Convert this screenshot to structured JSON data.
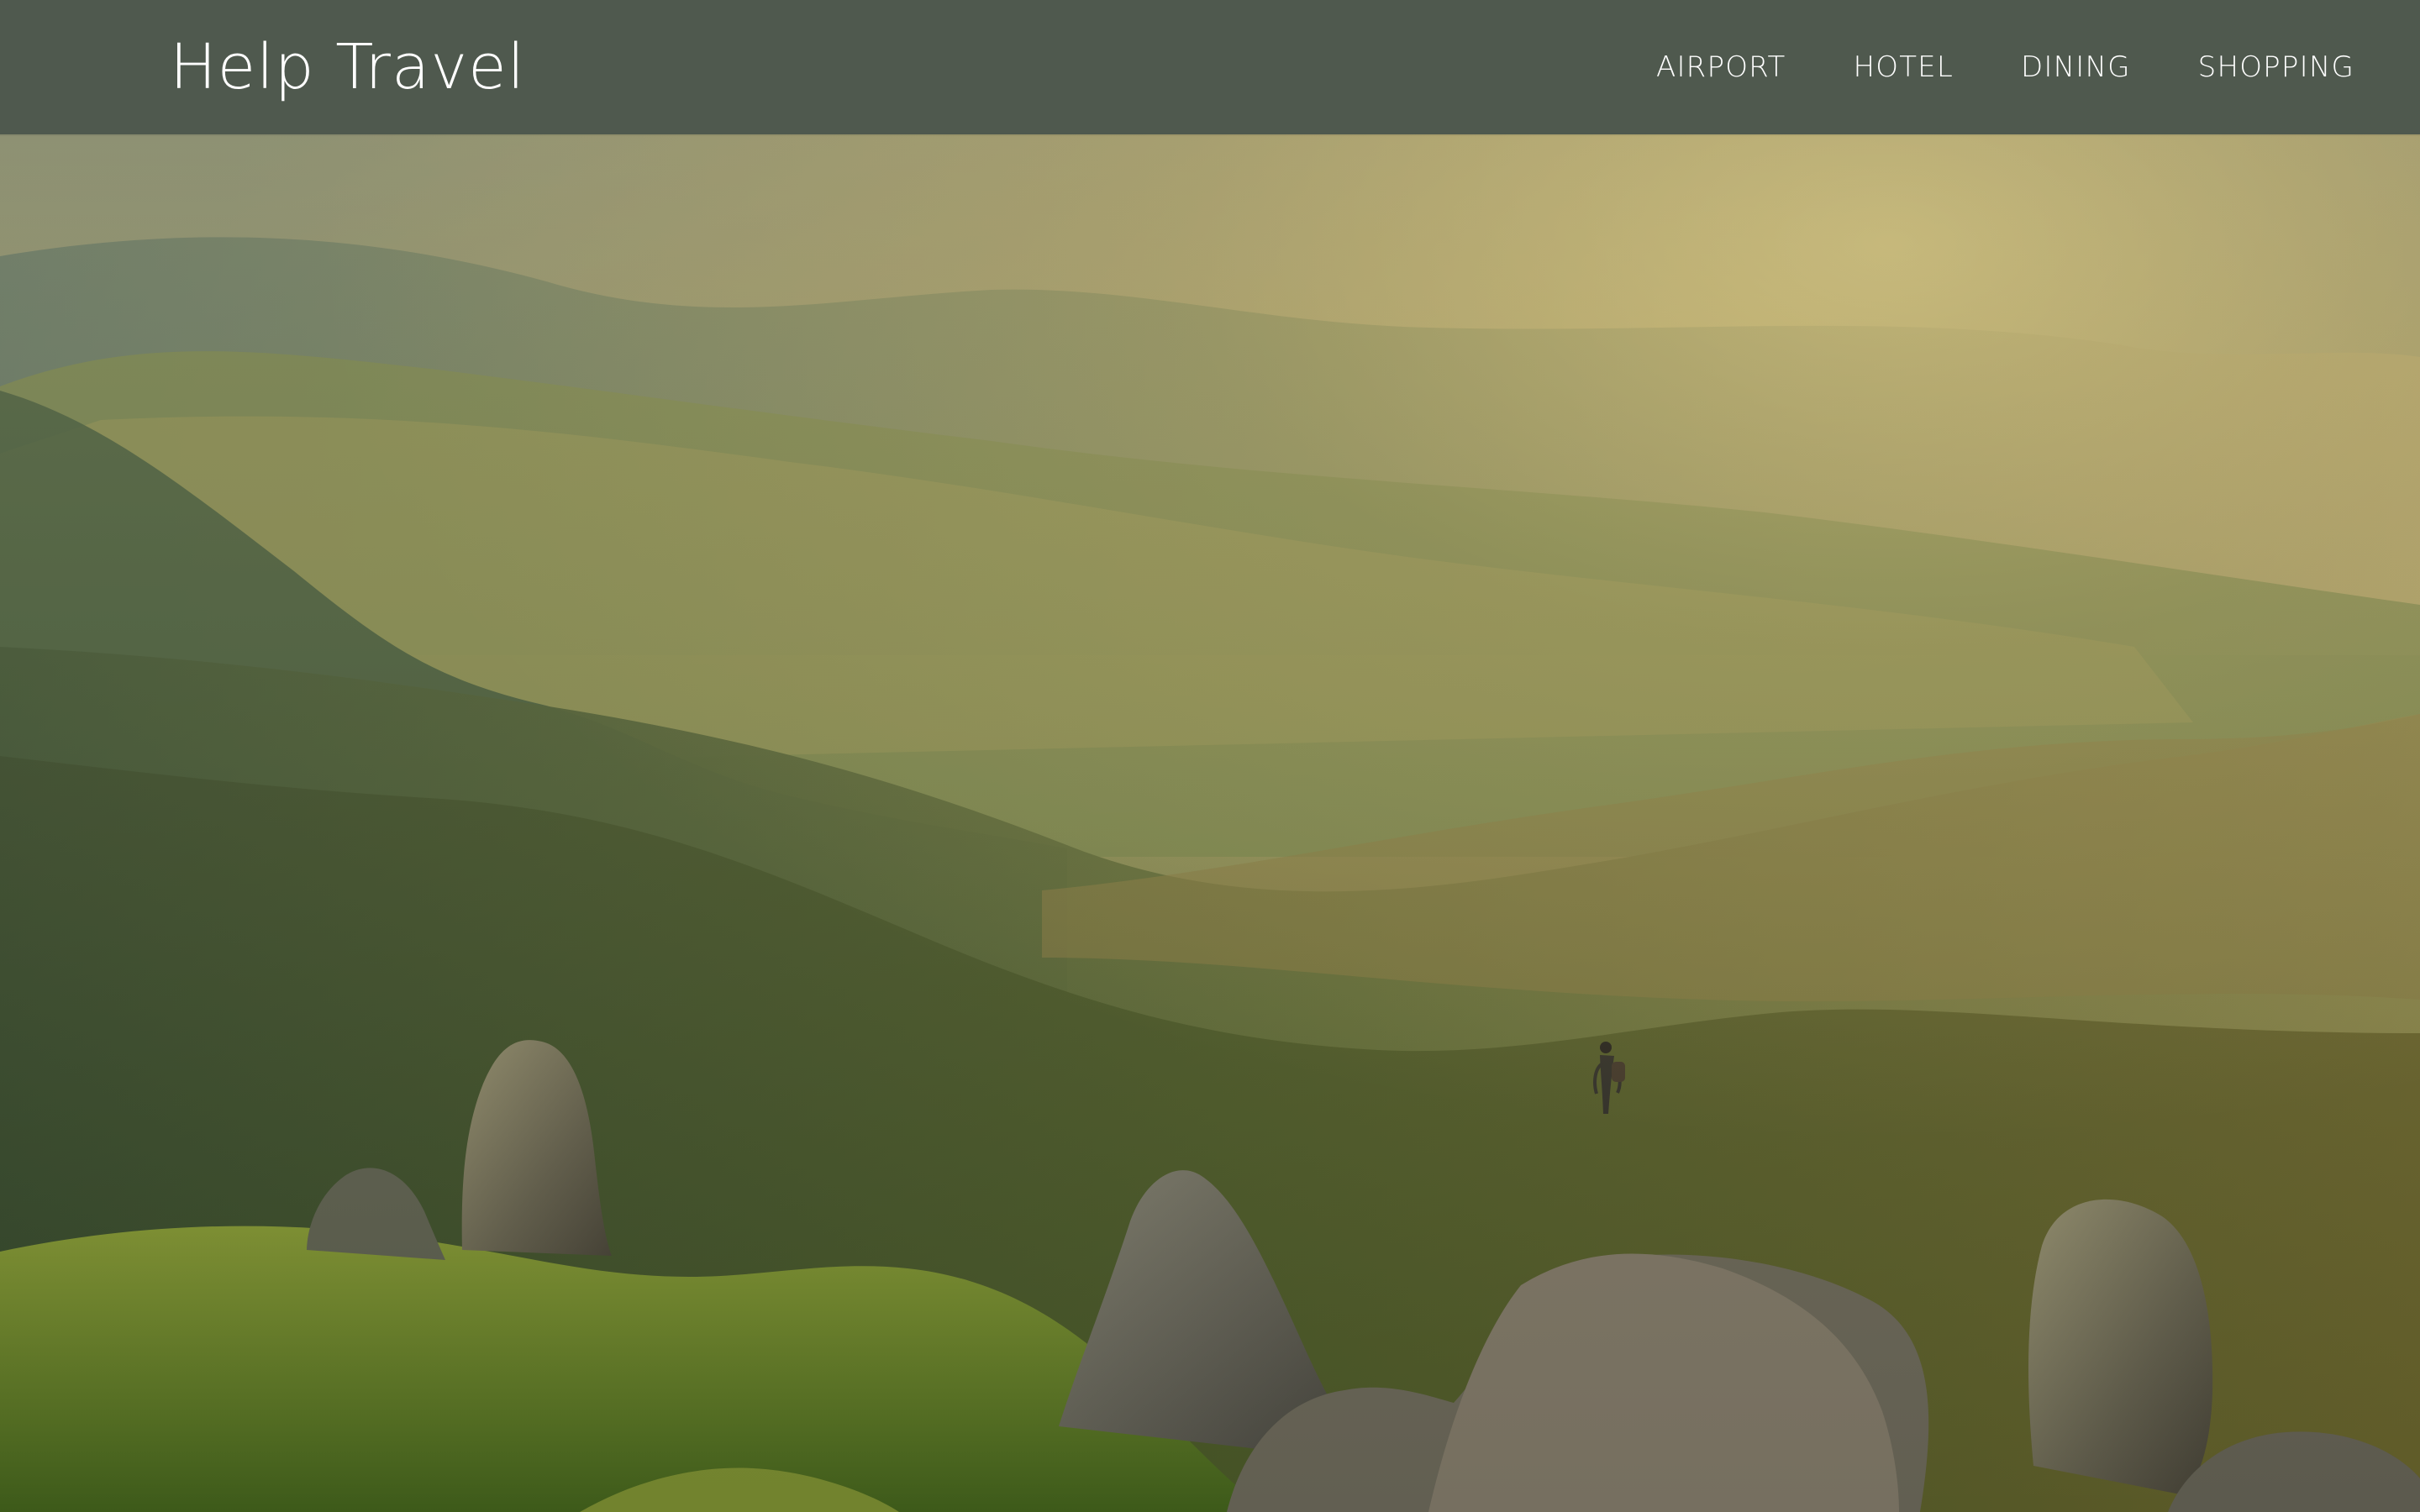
{
  "header": {
    "brand": "Help Travel",
    "nav": [
      {
        "label": "AIRPORT"
      },
      {
        "label": "HOTEL"
      },
      {
        "label": "DINING"
      },
      {
        "label": "SHOPPING"
      }
    ]
  },
  "hero": {
    "image_subject": "mountain landscape with rock spires and a hiker",
    "icon": "landscape-photo"
  },
  "colors": {
    "header_bg": "#4f594e",
    "text": "#ffffff"
  }
}
